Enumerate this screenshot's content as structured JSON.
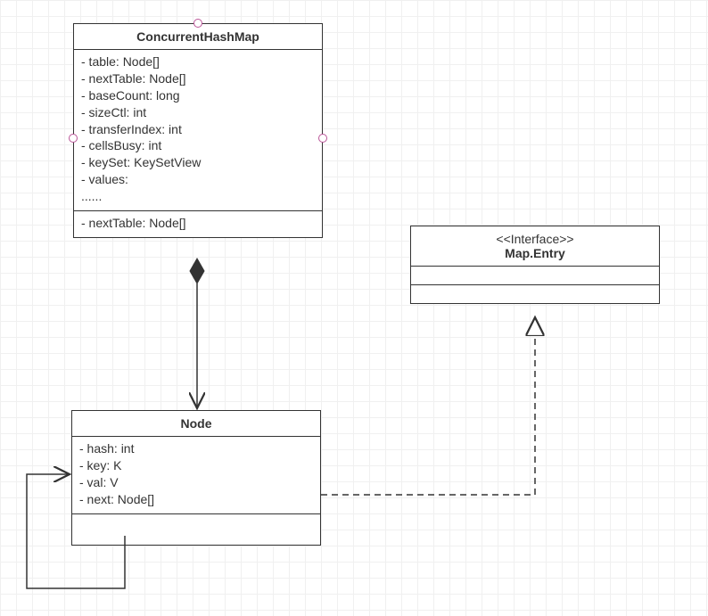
{
  "classes": {
    "chm": {
      "name": "ConcurrentHashMap",
      "attributes": [
        "- table: Node[]",
        "- nextTable: Node[]",
        "- baseCount: long",
        "- sizeCtl: int",
        "- transferIndex: int",
        "- cellsBusy: int",
        "- keySet: KeySetView",
        "- values:",
        "......"
      ],
      "operations": [
        "- nextTable: Node[]"
      ]
    },
    "node": {
      "name": "Node",
      "attributes": [
        "- hash: int",
        "- key: K",
        "- val: V",
        "- next: Node[]"
      ]
    },
    "entry": {
      "stereotype": "<<Interface>>",
      "name": "Map.Entry"
    }
  },
  "chart_data": {
    "type": "uml_class_diagram",
    "classes": [
      {
        "id": "ConcurrentHashMap",
        "kind": "class",
        "attributes": [
          {
            "vis": "-",
            "name": "table",
            "type": "Node[]"
          },
          {
            "vis": "-",
            "name": "nextTable",
            "type": "Node[]"
          },
          {
            "vis": "-",
            "name": "baseCount",
            "type": "long"
          },
          {
            "vis": "-",
            "name": "sizeCtl",
            "type": "int"
          },
          {
            "vis": "-",
            "name": "transferIndex",
            "type": "int"
          },
          {
            "vis": "-",
            "name": "cellsBusy",
            "type": "int"
          },
          {
            "vis": "-",
            "name": "keySet",
            "type": "KeySetView"
          },
          {
            "vis": "-",
            "name": "values",
            "type": ""
          }
        ],
        "operations": [
          {
            "vis": "-",
            "name": "nextTable",
            "type": "Node[]"
          }
        ]
      },
      {
        "id": "Node",
        "kind": "class",
        "attributes": [
          {
            "vis": "-",
            "name": "hash",
            "type": "int"
          },
          {
            "vis": "-",
            "name": "key",
            "type": "K"
          },
          {
            "vis": "-",
            "name": "val",
            "type": "V"
          },
          {
            "vis": "-",
            "name": "next",
            "type": "Node[]"
          }
        ]
      },
      {
        "id": "Map.Entry",
        "kind": "interface"
      }
    ],
    "relationships": [
      {
        "from": "ConcurrentHashMap",
        "to": "Node",
        "type": "composition"
      },
      {
        "from": "Node",
        "to": "Map.Entry",
        "type": "realization"
      },
      {
        "from": "Node",
        "to": "Node",
        "type": "association",
        "note": "self-reference"
      }
    ]
  }
}
